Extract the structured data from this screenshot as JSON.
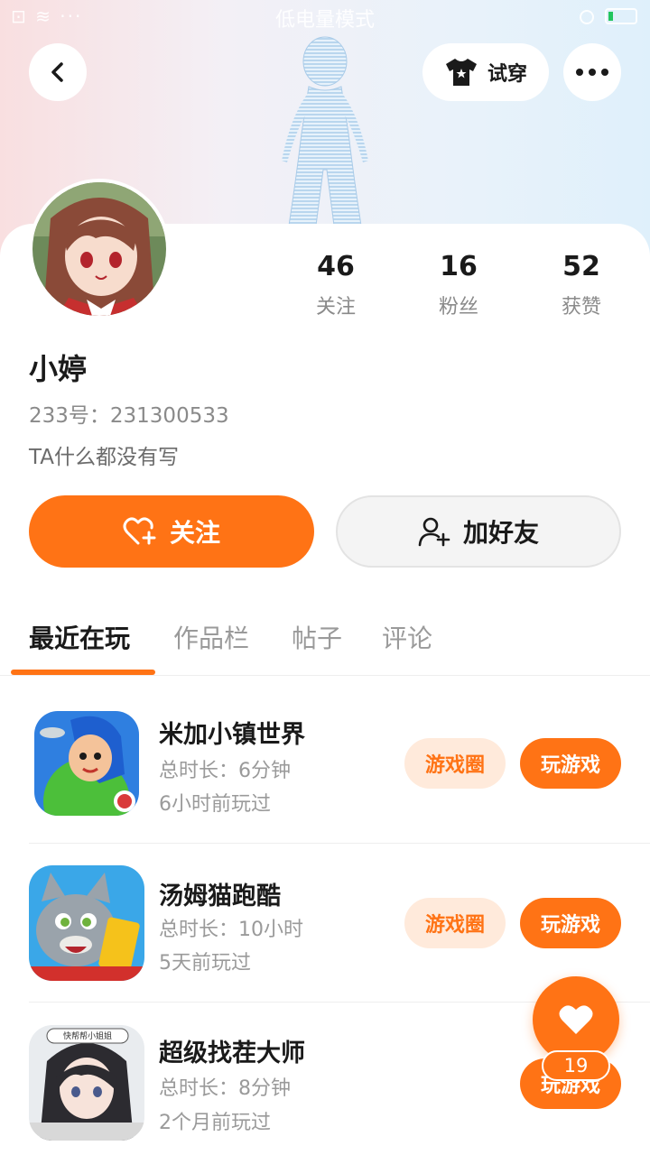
{
  "status_bar": {
    "left": "⊡ ≋ ···",
    "center": "低电量模式"
  },
  "header": {
    "tryon_label": "试穿"
  },
  "profile": {
    "username": "小婷",
    "uid": "233号：231300533",
    "bio": "TA什么都没有写",
    "stats": [
      {
        "value": "46",
        "label": "关注"
      },
      {
        "value": "16",
        "label": "粉丝"
      },
      {
        "value": "52",
        "label": "获赞"
      }
    ],
    "follow_label": "关注",
    "add_friend_label": "加好友"
  },
  "tabs": [
    {
      "label": "最近在玩",
      "active": true
    },
    {
      "label": "作品栏",
      "active": false
    },
    {
      "label": "帖子",
      "active": false
    },
    {
      "label": "评论",
      "active": false
    }
  ],
  "games": [
    {
      "title": "米加小镇世界",
      "duration": "总时长：6分钟",
      "last_played": "6小时前玩过",
      "circle_label": "游戏圈",
      "play_label": "玩游戏"
    },
    {
      "title": "汤姆猫跑酷",
      "duration": "总时长：10小时",
      "last_played": "5天前玩过",
      "circle_label": "游戏圈",
      "play_label": "玩游戏"
    },
    {
      "title": "超级找茬大师",
      "duration": "总时长：8分钟",
      "last_played": "2个月前玩过",
      "play_label": "玩游戏",
      "icon_caption": "快帮帮小姐姐"
    }
  ],
  "like": {
    "count": "19"
  },
  "colors": {
    "accent": "#ff7315",
    "accent_light": "#ffeadb"
  }
}
